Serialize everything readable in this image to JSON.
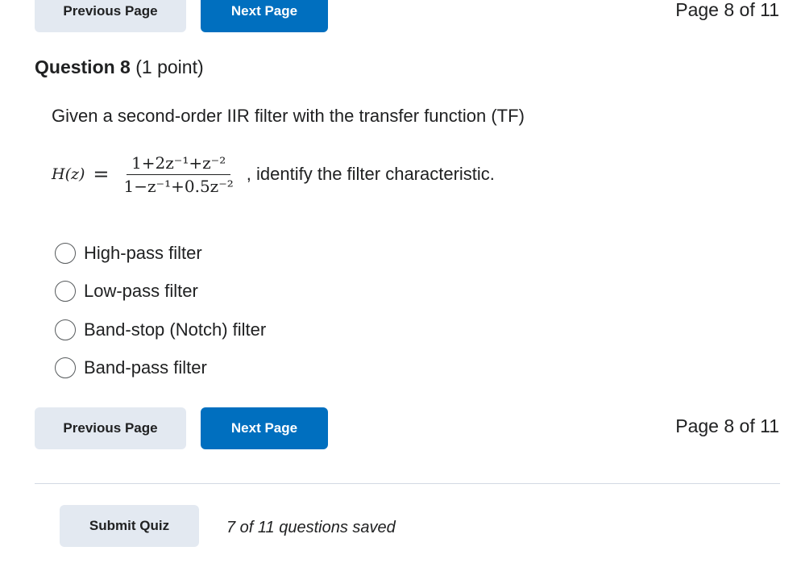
{
  "nav_top": {
    "prev_label": "Previous Page",
    "next_label": "Next Page",
    "page_indicator": "Page 8 of 11"
  },
  "question": {
    "title": "Question 8",
    "points": "(1 point)",
    "text": "Given a second-order IIR filter with the transfer function (TF)",
    "formula_lhs": "H(z)",
    "formula_eq": "=",
    "formula_numerator": "1+2z⁻¹+z⁻²",
    "formula_denominator": "1−z⁻¹+0.5z⁻²",
    "formula_suffix": ", identify the filter characteristic.",
    "options": [
      {
        "label": "High-pass filter"
      },
      {
        "label": "Low-pass filter"
      },
      {
        "label": "Band-stop (Notch) filter"
      },
      {
        "label": "Band-pass filter"
      }
    ]
  },
  "nav_bottom": {
    "prev_label": "Previous Page",
    "next_label": "Next Page",
    "page_indicator": "Page 8 of 11"
  },
  "footer": {
    "submit_label": "Submit Quiz",
    "saved_status": "7 of 11 questions saved"
  },
  "colors": {
    "primary": "#006fbf",
    "secondary": "#e3e9f1"
  }
}
